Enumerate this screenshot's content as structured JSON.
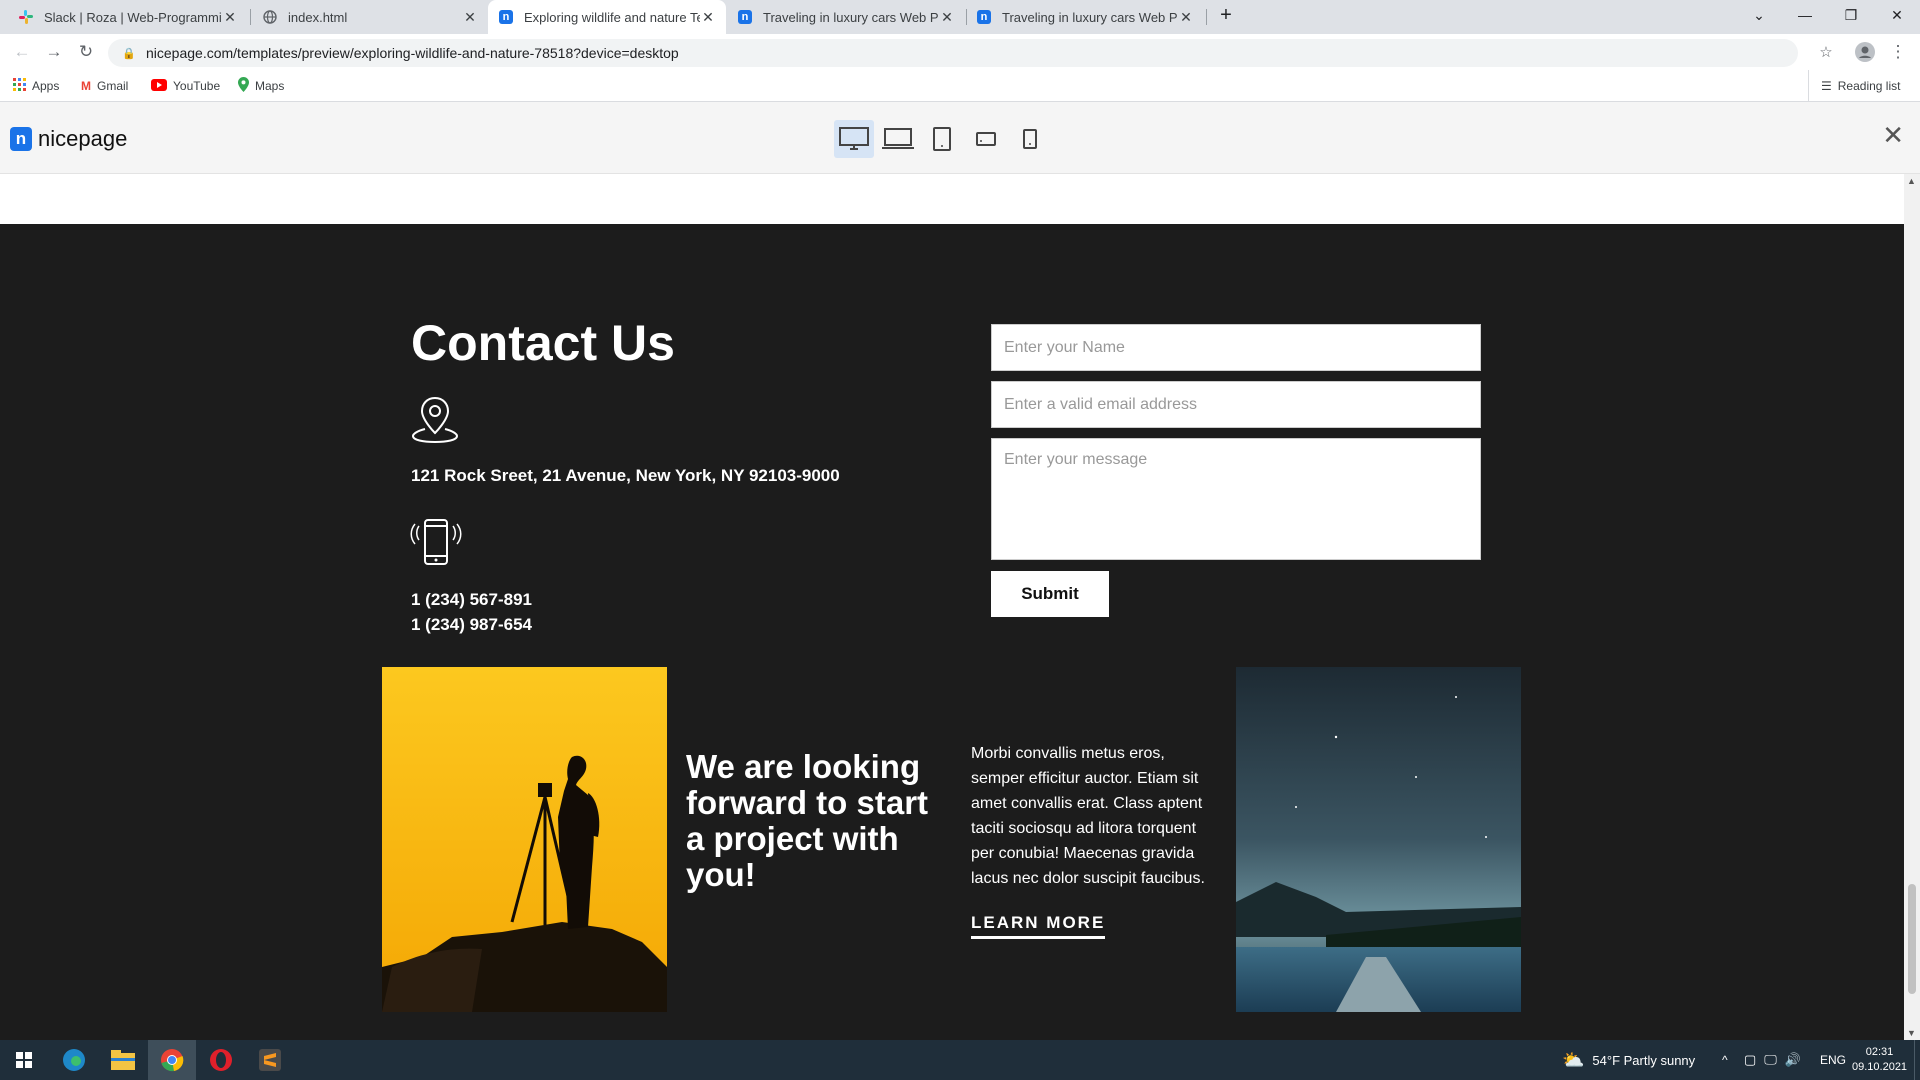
{
  "browser": {
    "tabs": [
      {
        "title": "Slack | Roza | Web-Programming",
        "icon": "slack-icon"
      },
      {
        "title": "index.html",
        "icon": "globe-icon"
      },
      {
        "title": "Exploring wildlife and nature Ten",
        "icon": "nicepage-icon"
      },
      {
        "title": "Traveling in luxury cars Web Page",
        "icon": "nicepage-icon"
      },
      {
        "title": "Traveling in luxury cars Web Page",
        "icon": "nicepage-icon"
      }
    ],
    "url": "nicepage.com/templates/preview/exploring-wildlife-and-nature-78518?device=desktop",
    "bookmarks": [
      {
        "label": "Apps",
        "icon": "apps-grid-icon"
      },
      {
        "label": "Gmail",
        "icon": "gmail-icon"
      },
      {
        "label": "YouTube",
        "icon": "youtube-icon"
      },
      {
        "label": "Maps",
        "icon": "maps-icon"
      }
    ],
    "reading_list": "Reading list"
  },
  "nicepage": {
    "logo": "nicepage",
    "devices": [
      "desktop-icon",
      "laptop-icon",
      "tablet-icon",
      "tablet-landscape-icon",
      "phone-icon"
    ]
  },
  "contact": {
    "title": "Contact Us",
    "address": "121 Rock Sreet, 21 Avenue, New York, NY 92103-9000",
    "phone1": "1 (234) 567-891",
    "phone2": "1 (234) 987-654",
    "form": {
      "name_placeholder": "Enter your Name",
      "email_placeholder": "Enter a valid email address",
      "message_placeholder": "Enter your message",
      "submit": "Submit"
    }
  },
  "promo": {
    "headline": "We are looking forward to start a project with you!",
    "paragraph": "Morbi convallis metus eros, semper efficitur auctor. Etiam sit amet convallis erat. Class aptent taciti sociosqu ad litora torquent per conubia! Maecenas gravida lacus nec dolor suscipit faucibus.",
    "link": "LEARN MORE"
  },
  "taskbar": {
    "weather": "54°F  Partly sunny",
    "lang": "ENG",
    "time": "02:31",
    "date": "09.10.2021"
  }
}
